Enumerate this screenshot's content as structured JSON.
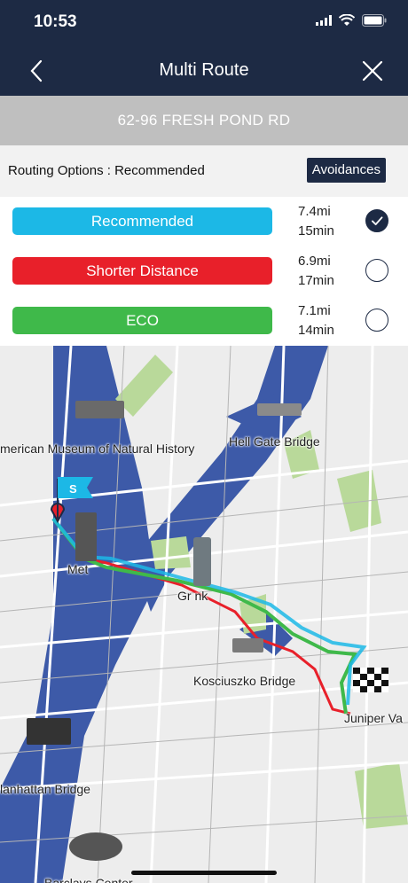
{
  "status": {
    "time": "10:53"
  },
  "nav": {
    "title": "Multi Route"
  },
  "address": "62-96 FRESH POND RD",
  "routing": {
    "label": "Routing Options : Recommended",
    "avoid_label": "Avoidances"
  },
  "routes": [
    {
      "name": "Recommended",
      "distance": "7.4mi",
      "time": "15min",
      "color": "#1cb8e6",
      "selected": true
    },
    {
      "name": "Shorter Distance",
      "distance": "6.9mi",
      "time": "17min",
      "color": "#e8202a",
      "selected": false
    },
    {
      "name": "ECO",
      "distance": "7.1mi",
      "time": "14min",
      "color": "#3fb94a",
      "selected": false
    }
  ],
  "map": {
    "labels": {
      "museum": "merican Museum of Natural History",
      "hellgate": "Hell Gate Bridge",
      "metlife": "Met",
      "greenpoint": "Gr    nk",
      "kosciuszko": "Kosciuszko Bridge",
      "juniper": "Juniper Va",
      "manhattan": "lanhattan Bridge",
      "barclays": "Barclays Center"
    },
    "start_flag": "S"
  }
}
